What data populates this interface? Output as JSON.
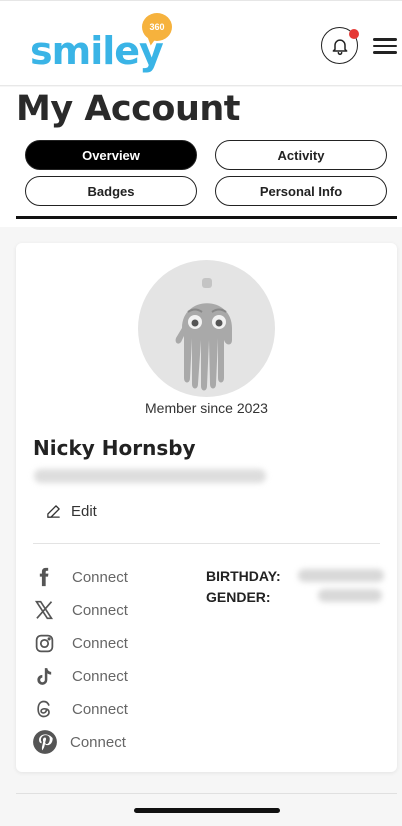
{
  "header": {
    "logo_text": "smiley",
    "logo_badge": "360",
    "notification_dot_color": "#e53935",
    "brand_color": "#3ab4e6",
    "badge_color": "#f6b23d"
  },
  "page": {
    "title": "My Account"
  },
  "tabs": [
    {
      "label": "Overview",
      "active": true
    },
    {
      "label": "Activity",
      "active": false
    },
    {
      "label": "Badges",
      "active": false
    },
    {
      "label": "Personal Info",
      "active": false
    }
  ],
  "profile": {
    "member_since": "Member since 2023",
    "name": "Nicky Hornsby",
    "edit_label": "Edit"
  },
  "social": [
    {
      "icon": "facebook-icon",
      "label": "Connect"
    },
    {
      "icon": "x-icon",
      "label": "Connect"
    },
    {
      "icon": "instagram-icon",
      "label": "Connect"
    },
    {
      "icon": "tiktok-icon",
      "label": "Connect"
    },
    {
      "icon": "threads-icon",
      "label": "Connect"
    },
    {
      "icon": "pinterest-icon",
      "label": "Connect"
    }
  ],
  "personal_info": {
    "birthday_label": "BIRTHDAY:",
    "gender_label": "GENDER:"
  }
}
